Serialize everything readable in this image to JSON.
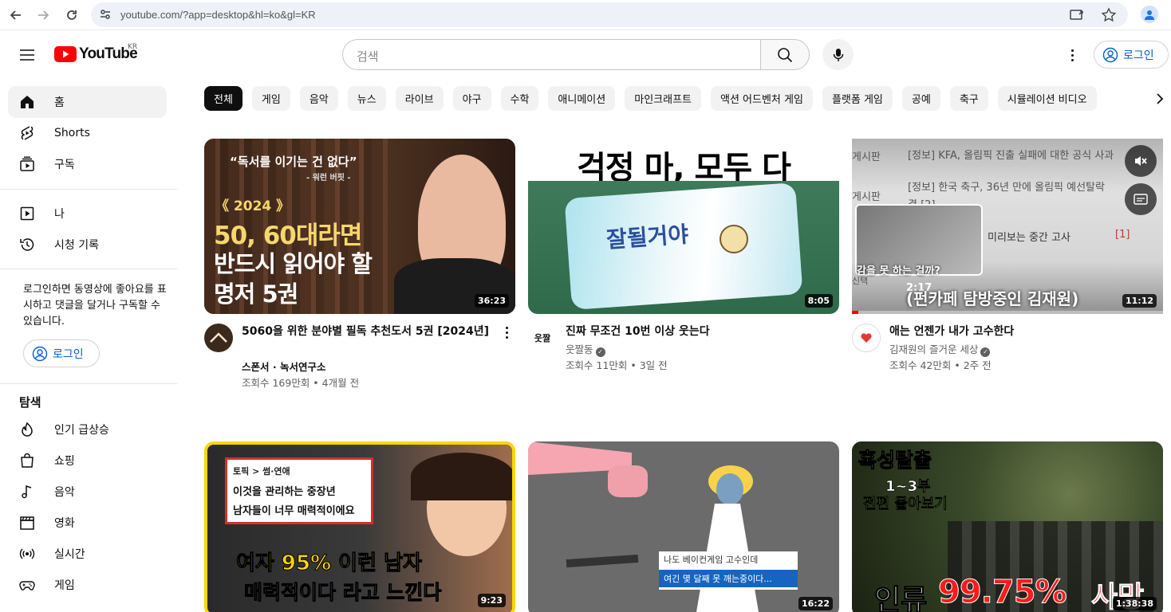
{
  "browser": {
    "url": "youtube.com/?app=desktop&hl=ko&gl=KR"
  },
  "masthead": {
    "logo_text": "YouTube",
    "country_code": "KR",
    "search_placeholder": "검색",
    "signin_label": "로그인"
  },
  "sidebar": {
    "items": [
      {
        "label": "홈",
        "icon": "home-icon"
      },
      {
        "label": "Shorts",
        "icon": "shorts-icon"
      },
      {
        "label": "구독",
        "icon": "subscriptions-icon"
      },
      {
        "label": "나",
        "icon": "you-icon"
      },
      {
        "label": "시청 기록",
        "icon": "history-icon"
      }
    ],
    "signin_note": "로그인하면 동영상에 좋아요를 표시하고 댓글을 달거나 구독할 수 있습니다.",
    "signin_label": "로그인",
    "explore_heading": "탐색",
    "explore_items": [
      {
        "label": "인기 급상승",
        "icon": "trending-icon"
      },
      {
        "label": "쇼핑",
        "icon": "shopping-icon"
      },
      {
        "label": "음악",
        "icon": "music-icon"
      },
      {
        "label": "영화",
        "icon": "movies-icon"
      },
      {
        "label": "실시간",
        "icon": "live-icon"
      },
      {
        "label": "게임",
        "icon": "gaming-icon"
      }
    ]
  },
  "chips": [
    "전체",
    "게임",
    "음악",
    "뉴스",
    "라이브",
    "야구",
    "수학",
    "애니메이션",
    "마인크래프트",
    "액션 어드벤처 게임",
    "플랫폼 게임",
    "공예",
    "축구",
    "시뮬레이션 비디오"
  ],
  "videos": [
    {
      "title": "5060을 위한 분야별 필독 추천도서 5권 [2024년]",
      "channel": "스폰서 · 녹서연구소",
      "meta": "조회수 169만회 • 4개월 전",
      "duration": "36:23",
      "thumb_text": [
        "“독서를 이기는 건 없다”",
        "- 워런 버핏 -",
        "《 2024 》",
        "50, 60대라면",
        "반드시 읽어야 할",
        "명저 5권"
      ]
    },
    {
      "title": "진짜 무조건 10번 이상 웃는다",
      "channel": "웃짤동",
      "meta": "조회수 11만회 • 3일 전",
      "duration": "8:05",
      "thumb_text": [
        "걱정 마, 모두 다",
        "잘될거야"
      ]
    },
    {
      "title": "애는 언젠가 내가 고수한다",
      "channel": "김재원의 즐거운 세상",
      "meta": "조회수 42만회 • 2주 전",
      "duration": "11:12",
      "thumb_text": [
        "게시판",
        "[정보] KFA, 올림픽 진출 실패에 대한 공식 사과",
        "게시판",
        "[정보] 한국 축구, 36년 만에 올림픽 예선탈락",
        "결 [2]",
        "미리보는 중간 고사",
        "[1]",
        "감을 못 하는 걸까?",
        "2:17",
        "(펀카페 탐방중인 김재원)",
        "신택"
      ]
    },
    {
      "duration": "9:23",
      "thumb_text": [
        "토픽 > 썸·연애",
        "이것을 관리하는 중장년",
        "남자들이 너무 매력적이에요",
        "여자 95% 이런 남자",
        "매력적이다 라고 느낀다"
      ]
    },
    {
      "duration": "16:22",
      "thumb_text": [
        "나도 베이컨게임 고수인데",
        "여긴 몇 달째 못 깨는중이다..."
      ]
    },
    {
      "duration": "1:38:38",
      "thumb_text": [
        "혹성탈출",
        "1~3부",
        "전편 몰아보기",
        "인류",
        "99.75%",
        "사망"
      ]
    }
  ]
}
